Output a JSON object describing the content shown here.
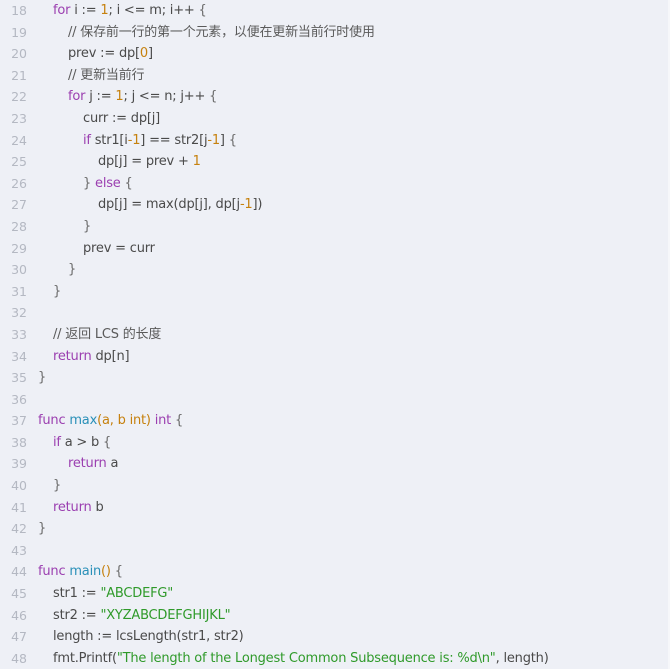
{
  "editor": {
    "language": "go",
    "lines": [
      {
        "n": "18",
        "indent": 1,
        "tokens": [
          [
            "kw",
            "for"
          ],
          [
            "plain",
            " i := "
          ],
          [
            "num",
            "1"
          ],
          [
            "plain",
            "; i <= m; i++ "
          ],
          [
            "pn",
            "{"
          ]
        ]
      },
      {
        "n": "19",
        "indent": 2,
        "tokens": [
          [
            "cm",
            "// 保存前一行的第一个元素，以便在更新当前行时使用"
          ]
        ]
      },
      {
        "n": "20",
        "indent": 2,
        "tokens": [
          [
            "plain",
            "prev := dp["
          ],
          [
            "num",
            "0"
          ],
          [
            "plain",
            "]"
          ]
        ]
      },
      {
        "n": "21",
        "indent": 2,
        "tokens": [
          [
            "cm",
            "// 更新当前行"
          ]
        ]
      },
      {
        "n": "22",
        "indent": 2,
        "tokens": [
          [
            "kw",
            "for"
          ],
          [
            "plain",
            " j := "
          ],
          [
            "num",
            "1"
          ],
          [
            "plain",
            "; j <= n; j++ "
          ],
          [
            "pn",
            "{"
          ]
        ]
      },
      {
        "n": "23",
        "indent": 3,
        "tokens": [
          [
            "plain",
            "curr := dp[j]"
          ]
        ]
      },
      {
        "n": "24",
        "indent": 3,
        "tokens": [
          [
            "kw",
            "if"
          ],
          [
            "plain",
            " str1[i"
          ],
          [
            "num",
            "-1"
          ],
          [
            "plain",
            "] == str2[j"
          ],
          [
            "num",
            "-1"
          ],
          [
            "plain",
            "] "
          ],
          [
            "pn",
            "{"
          ]
        ]
      },
      {
        "n": "25",
        "indent": 4,
        "tokens": [
          [
            "plain",
            "dp[j] = prev + "
          ],
          [
            "num",
            "1"
          ]
        ]
      },
      {
        "n": "26",
        "indent": 3,
        "tokens": [
          [
            "pn",
            "} "
          ],
          [
            "kw",
            "else"
          ],
          [
            "pn",
            " {"
          ]
        ]
      },
      {
        "n": "27",
        "indent": 4,
        "tokens": [
          [
            "plain",
            "dp[j] = max(dp[j], dp[j"
          ],
          [
            "num",
            "-1"
          ],
          [
            "plain",
            "])"
          ]
        ]
      },
      {
        "n": "28",
        "indent": 3,
        "tokens": [
          [
            "pn",
            "}"
          ]
        ]
      },
      {
        "n": "29",
        "indent": 3,
        "tokens": [
          [
            "plain",
            "prev = curr"
          ]
        ]
      },
      {
        "n": "30",
        "indent": 2,
        "tokens": [
          [
            "pn",
            "}"
          ]
        ]
      },
      {
        "n": "31",
        "indent": 1,
        "tokens": [
          [
            "pn",
            "}"
          ]
        ]
      },
      {
        "n": "32",
        "indent": 0,
        "tokens": []
      },
      {
        "n": "33",
        "indent": 1,
        "tokens": [
          [
            "cm",
            "// 返回 LCS 的长度"
          ]
        ]
      },
      {
        "n": "34",
        "indent": 1,
        "tokens": [
          [
            "kw",
            "return"
          ],
          [
            "plain",
            " dp[n]"
          ]
        ]
      },
      {
        "n": "35",
        "indent": 0,
        "tokens": [
          [
            "pn",
            "}"
          ]
        ]
      },
      {
        "n": "36",
        "indent": 0,
        "tokens": []
      },
      {
        "n": "37",
        "indent": 0,
        "tokens": [
          [
            "kw",
            "func"
          ],
          [
            "plain",
            " "
          ],
          [
            "fn",
            "max"
          ],
          [
            "par",
            "(a, b int)"
          ],
          [
            "plain",
            " "
          ],
          [
            "kw",
            "int"
          ],
          [
            "pn",
            " {"
          ]
        ]
      },
      {
        "n": "38",
        "indent": 1,
        "tokens": [
          [
            "kw",
            "if"
          ],
          [
            "plain",
            " a > b "
          ],
          [
            "pn",
            "{"
          ]
        ]
      },
      {
        "n": "39",
        "indent": 2,
        "tokens": [
          [
            "kw",
            "return"
          ],
          [
            "plain",
            " a"
          ]
        ]
      },
      {
        "n": "40",
        "indent": 1,
        "tokens": [
          [
            "pn",
            "}"
          ]
        ]
      },
      {
        "n": "41",
        "indent": 1,
        "tokens": [
          [
            "kw",
            "return"
          ],
          [
            "plain",
            " b"
          ]
        ]
      },
      {
        "n": "42",
        "indent": 0,
        "tokens": [
          [
            "pn",
            "}"
          ]
        ]
      },
      {
        "n": "43",
        "indent": 0,
        "tokens": []
      },
      {
        "n": "44",
        "indent": 0,
        "tokens": [
          [
            "kw",
            "func"
          ],
          [
            "plain",
            " "
          ],
          [
            "fn",
            "main"
          ],
          [
            "par",
            "()"
          ],
          [
            "pn",
            " {"
          ]
        ]
      },
      {
        "n": "45",
        "indent": 1,
        "tokens": [
          [
            "plain",
            "str1 := "
          ],
          [
            "str",
            "\"ABCDEFG\""
          ]
        ]
      },
      {
        "n": "46",
        "indent": 1,
        "tokens": [
          [
            "plain",
            "str2 := "
          ],
          [
            "str",
            "\"XYZABCDEFGHIJKL\""
          ]
        ]
      },
      {
        "n": "47",
        "indent": 1,
        "tokens": [
          [
            "plain",
            "length := lcsLength(str1, str2)"
          ]
        ]
      },
      {
        "n": "48",
        "indent": 1,
        "tokens": [
          [
            "plain",
            "fmt.Printf("
          ],
          [
            "str",
            "\"The length of the Longest Common Subsequence is: %d\\n\""
          ],
          [
            "plain",
            ", length)"
          ]
        ]
      }
    ]
  }
}
